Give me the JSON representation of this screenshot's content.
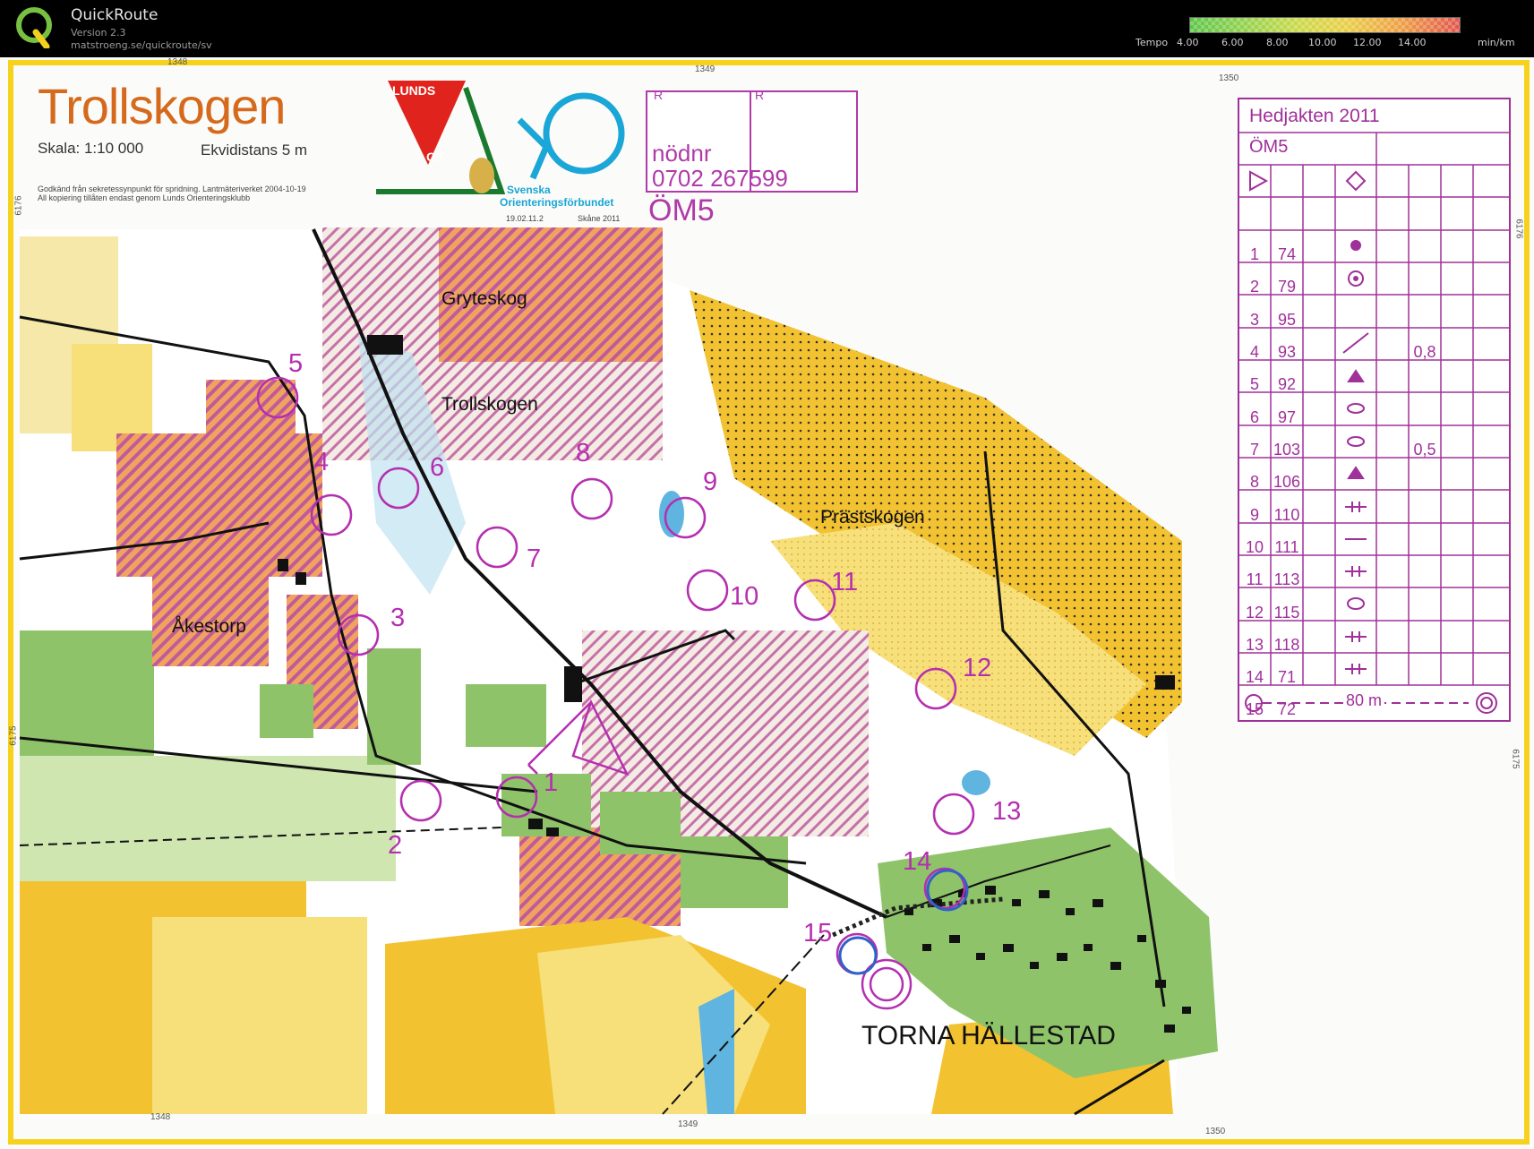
{
  "app": {
    "name": "QuickRoute",
    "version": "Version 2.3",
    "url": "matstroeng.se/quickroute/sv",
    "logo_letter": "Q"
  },
  "tempo": {
    "label": "Tempo",
    "ticks": [
      "4.00",
      "6.00",
      "8.00",
      "10.00",
      "12.00",
      "14.00"
    ],
    "unit": "min/km"
  },
  "map": {
    "title": "Trollskogen",
    "scale": "Skala: 1:10 000",
    "contour": "Ekvidistans 5 m",
    "notice_line1": "Godkänd från sekretessynpunkt för spridning. Lantmäteriverket 2004-10-19",
    "notice_line2": "All kopiering tillåten endast genom Lunds Orienteringsklubb",
    "club_top": "LUNDS",
    "club_bottom": "OK",
    "federation_line1": "Svenska",
    "federation_line2": "Orienteringsförbundet",
    "federation_date": "19.02.11.2",
    "federation_place": "Skåne 2011",
    "r_left": "R",
    "r_right": "R",
    "emergency_label": "nödnr",
    "emergency_number": "0702 267599",
    "class": "ÖM5",
    "places": {
      "gryteskog": "Gryteskog",
      "trollskogen": "Trollskogen",
      "akestorp": "Åkestorp",
      "prastskogen": "Prästskogen",
      "torna": "TORNA HÄLLESTAD"
    },
    "grid_labels": {
      "top_1348": "1348",
      "top_1349": "1349",
      "top_1350": "1350",
      "bottom_1348": "1348",
      "bottom_1349": "1349",
      "bottom_1350": "1350",
      "left_6176": "6176",
      "left_6175": "6175",
      "right_6176": "6176",
      "right_6175": "6175"
    },
    "controls": [
      "1",
      "2",
      "3",
      "4",
      "5",
      "6",
      "7",
      "8",
      "9",
      "10",
      "11",
      "12",
      "13",
      "14",
      "15"
    ]
  },
  "description": {
    "title": "Hedjakten 2011",
    "class": "ÖM5",
    "rows": [
      {
        "num": "1",
        "code": "74",
        "dim": ""
      },
      {
        "num": "2",
        "code": "79",
        "dim": ""
      },
      {
        "num": "3",
        "code": "95",
        "dim": ""
      },
      {
        "num": "4",
        "code": "93",
        "dim": "0,8"
      },
      {
        "num": "5",
        "code": "92",
        "dim": ""
      },
      {
        "num": "6",
        "code": "97",
        "dim": ""
      },
      {
        "num": "7",
        "code": "103",
        "dim": "0,5"
      },
      {
        "num": "8",
        "code": "106",
        "dim": ""
      },
      {
        "num": "9",
        "code": "110",
        "dim": ""
      },
      {
        "num": "10",
        "code": "111",
        "dim": ""
      },
      {
        "num": "11",
        "code": "113",
        "dim": ""
      },
      {
        "num": "12",
        "code": "115",
        "dim": ""
      },
      {
        "num": "13",
        "code": "118",
        "dim": ""
      },
      {
        "num": "14",
        "code": "71",
        "dim": ""
      },
      {
        "num": "15",
        "code": "72",
        "dim": ""
      }
    ],
    "finish": "80 m"
  },
  "colors": {
    "course": "#b52fb0",
    "open_land": "#f2c231",
    "rough_open": "#f7df7a",
    "forest_green": "#8fc36a",
    "light_green": "#cfe6b0",
    "cultivated": "#e8a060",
    "map_border": "#f6d21c"
  }
}
